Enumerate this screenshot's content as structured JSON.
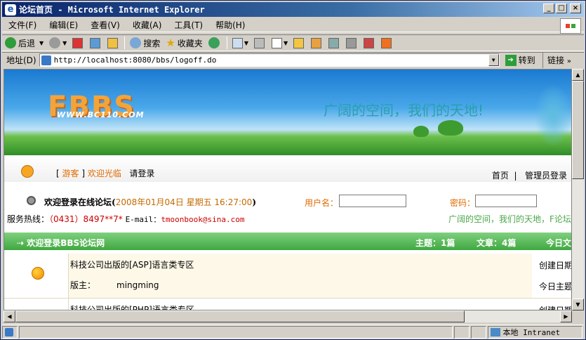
{
  "window": {
    "title": "论坛首页 - Microsoft Internet Explorer",
    "buttons": {
      "minimize": "_",
      "maximize": "□",
      "close": "×"
    }
  },
  "menu": [
    "文件(F)",
    "编辑(E)",
    "查看(V)",
    "收藏(A)",
    "工具(T)",
    "帮助(H)"
  ],
  "toolbar": {
    "back": "后退",
    "search": "搜索",
    "favorites": "收藏夹"
  },
  "address": {
    "label": "地址(D)",
    "url": "http://localhost:8080/bbs/logoff.do",
    "go": "转到",
    "links": "链接"
  },
  "banner": {
    "logo": "FBBS",
    "logo_sub": "WWW.BC110.COM",
    "slogan": "广阔的空间，我们的天地!"
  },
  "user": {
    "bracket_open": "[",
    "guest": "游客",
    "bracket_close": "]",
    "welcome": "欢迎光临",
    "login_prompt": "请登录",
    "home": "首页",
    "divider": "|",
    "admin_login": "管理员登录"
  },
  "welcome": {
    "text": "欢迎登录在线论坛",
    "paren_open": "(",
    "datetime": "2008年01月04日 星期五 16:27:00",
    "paren_close": ")",
    "username_label": "用户名：",
    "password_label": "密码："
  },
  "hotline": {
    "label": "服务热线：",
    "phone": "（0431）8497**7*",
    "email_label": "E-mail：",
    "email": "tmoonbook@sina.com"
  },
  "marquee": "广阔的空间，我们的天地，F论坛",
  "forum_header": {
    "title": "欢迎登录BBS论坛网",
    "topics": "主题：1篇",
    "articles": "文章：4篇",
    "today": "今日文"
  },
  "forums": [
    {
      "title": "科技公司出版的[ASP]语言类专区",
      "moderator_label": "版主：",
      "moderator": "mingming",
      "created": "创建日期",
      "today_topics": "今日主题"
    },
    {
      "title": "科技公司出版的[PHP]语言类专区",
      "created": "创建日期"
    }
  ],
  "status": {
    "zone": "本地 Intranet"
  }
}
